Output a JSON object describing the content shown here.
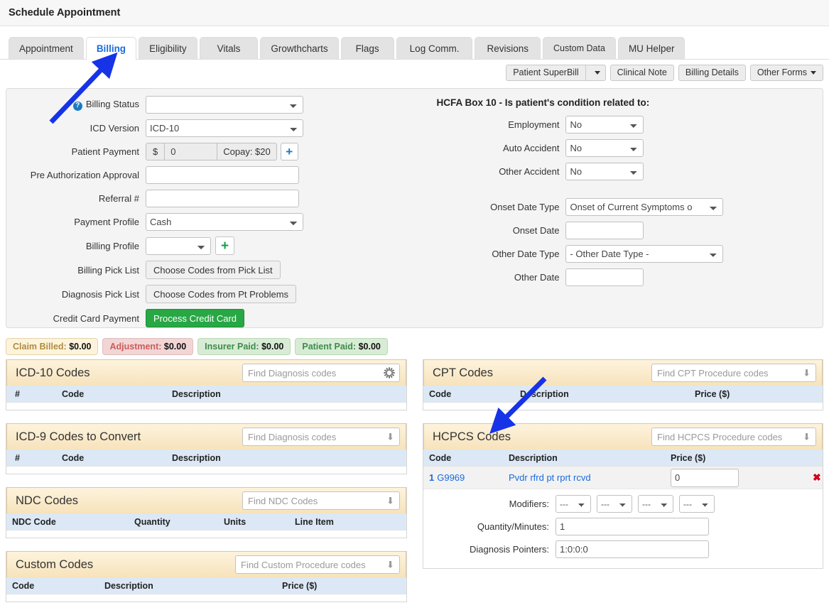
{
  "page": {
    "title": "Schedule Appointment"
  },
  "tabs": [
    {
      "label": "Appointment",
      "active": false
    },
    {
      "label": "Billing",
      "active": true
    },
    {
      "label": "Eligibility",
      "active": false
    },
    {
      "label": "Vitals",
      "active": false
    },
    {
      "label": "Growthcharts",
      "active": false
    },
    {
      "label": "Flags",
      "active": false
    },
    {
      "label": "Log Comm.",
      "active": false
    },
    {
      "label": "Revisions",
      "active": false
    },
    {
      "label": "Custom Data",
      "active": false
    },
    {
      "label": "MU Helper",
      "active": false
    }
  ],
  "toolbar": {
    "patient_superbill": "Patient SuperBill",
    "superbill_caret": "▾",
    "clinical_note": "Clinical Note",
    "billing_details": "Billing Details",
    "other_forms": "Other Forms"
  },
  "billing_form": {
    "billing_status": {
      "label": "Billing Status",
      "value": "",
      "help_icon": "question-mark-icon"
    },
    "icd_version": {
      "label": "ICD Version",
      "value": "ICD-10"
    },
    "patient_payment": {
      "label": "Patient Payment",
      "currency": "$",
      "value": "0",
      "copay": "Copay: $20",
      "add": "+"
    },
    "pre_auth": {
      "label": "Pre Authorization Approval",
      "value": ""
    },
    "referral": {
      "label": "Referral #",
      "value": ""
    },
    "payment_profile": {
      "label": "Payment Profile",
      "value": "Cash"
    },
    "billing_profile": {
      "label": "Billing Profile",
      "value": "",
      "add": "+"
    },
    "billing_pick_list": {
      "label": "Billing Pick List",
      "button": "Choose Codes from Pick List"
    },
    "diagnosis_pick_list": {
      "label": "Diagnosis Pick List",
      "button": "Choose Codes from Pt Problems"
    },
    "credit_card": {
      "label": "Credit Card Payment",
      "button": "Process Credit Card"
    }
  },
  "hcfa": {
    "title": "HCFA Box 10 - Is patient's condition related to:",
    "employment": {
      "label": "Employment",
      "value": "No"
    },
    "auto_accident": {
      "label": "Auto Accident",
      "value": "No"
    },
    "other_accident": {
      "label": "Other Accident",
      "value": "No"
    },
    "onset_date_type": {
      "label": "Onset Date Type",
      "value": "Onset of Current Symptoms o"
    },
    "onset_date": {
      "label": "Onset Date",
      "value": ""
    },
    "other_date_type": {
      "label": "Other Date Type",
      "value": "- Other Date Type -"
    },
    "other_date": {
      "label": "Other Date",
      "value": ""
    }
  },
  "badges": [
    {
      "label": "Claim Billed:",
      "amount": "$0.00",
      "bg": "#fdf3dd",
      "border": "#e6d4a8",
      "fg": "#b08d3c"
    },
    {
      "label": "Adjustment:",
      "amount": "$0.00",
      "bg": "#f2d6d6",
      "border": "#e0bdbd",
      "fg": "#cc5b5b"
    },
    {
      "label": "Insurer Paid:",
      "amount": "$0.00",
      "bg": "#d8ecd5",
      "border": "#b9d9b4",
      "fg": "#3d8b4d"
    },
    {
      "label": "Patient Paid:",
      "amount": "$0.00",
      "bg": "#d8ecd5",
      "border": "#b9d9b4",
      "fg": "#3d8b4d"
    }
  ],
  "sections": {
    "icd10": {
      "title": "ICD-10 Codes",
      "search_placeholder": "Find Diagnosis codes",
      "widget": "spinner",
      "columns": [
        "#",
        "Code",
        "Description"
      ],
      "rows": []
    },
    "icd9": {
      "title": "ICD-9 Codes to Convert",
      "search_placeholder": "Find Diagnosis codes",
      "widget": "arrow",
      "columns": [
        "#",
        "Code",
        "Description"
      ],
      "rows": []
    },
    "ndc": {
      "title": "NDC Codes",
      "search_placeholder": "Find NDC Codes",
      "widget": "arrow",
      "columns": [
        "NDC Code",
        "Quantity",
        "Units",
        "Line Item"
      ],
      "rows": []
    },
    "custom": {
      "title": "Custom Codes",
      "search_placeholder": "Find Custom Procedure codes",
      "widget": "arrow",
      "columns": [
        "Code",
        "Description",
        "Price ($)"
      ],
      "rows": []
    },
    "cpt": {
      "title": "CPT Codes",
      "search_placeholder": "Find CPT Procedure codes",
      "widget": "arrow",
      "columns": [
        "Code",
        "Description",
        "Price ($)"
      ],
      "rows": []
    },
    "hcpcs": {
      "title": "HCPCS Codes",
      "search_placeholder": "Find HCPCS Procedure codes",
      "widget": "arrow",
      "columns": [
        "Code",
        "Description",
        "Price ($)"
      ],
      "row": {
        "num": "1",
        "code": "G9969",
        "description": "Pvdr rfrd pt rprt rcvd",
        "price": "0",
        "delete_icon": "✖"
      },
      "detail": {
        "modifiers_label": "Modifiers:",
        "modifiers": [
          "---",
          "---",
          "---",
          "---"
        ],
        "quantity_label": "Quantity/Minutes:",
        "quantity_value": "1",
        "pointers_label": "Diagnosis Pointers:",
        "pointers_value": "1:0:0:0"
      }
    }
  },
  "annotations": {
    "accent": "#1733e8",
    "arrow_1": "points to Billing tab",
    "arrow_2": "points to HCPCS Codes section"
  }
}
